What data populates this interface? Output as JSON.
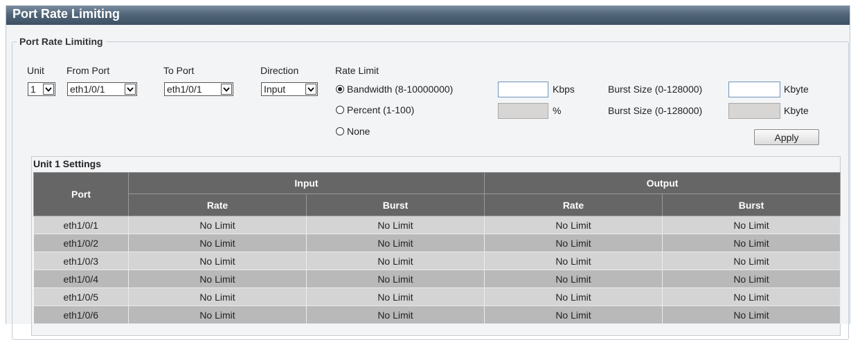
{
  "page": {
    "title": "Port Rate Limiting"
  },
  "form": {
    "legend": "Port Rate Limiting",
    "unit_label": "Unit",
    "unit_value": "1",
    "from_port_label": "From Port",
    "from_port_value": "eth1/0/1",
    "to_port_label": "To Port",
    "to_port_value": "eth1/0/1",
    "direction_label": "Direction",
    "direction_value": "Input",
    "rate_limit_label": "Rate Limit",
    "bandwidth_label": "Bandwidth (8-10000000)",
    "bandwidth_value": "",
    "bandwidth_unit": "Kbps",
    "percent_label": "Percent (1-100)",
    "percent_value": "",
    "percent_unit": "%",
    "none_label": "None",
    "selected_rate_limit": "Bandwidth",
    "burst_size_label_1": "Burst Size (0-128000)",
    "burst_size_value_1": "",
    "burst_unit_1": "Kbyte",
    "burst_size_label_2": "Burst Size (0-128000)",
    "burst_size_value_2": "",
    "burst_unit_2": "Kbyte",
    "apply_label": "Apply"
  },
  "settings": {
    "title": "Unit 1 Settings",
    "headers": {
      "port": "Port",
      "input": "Input",
      "output": "Output",
      "input_rate": "Rate",
      "input_burst": "Burst",
      "output_rate": "Rate",
      "output_burst": "Burst"
    },
    "rows": [
      {
        "port": "eth1/0/1",
        "input_rate": "No Limit",
        "input_burst": "No Limit",
        "output_rate": "No Limit",
        "output_burst": "No Limit"
      },
      {
        "port": "eth1/0/2",
        "input_rate": "No Limit",
        "input_burst": "No Limit",
        "output_rate": "No Limit",
        "output_burst": "No Limit"
      },
      {
        "port": "eth1/0/3",
        "input_rate": "No Limit",
        "input_burst": "No Limit",
        "output_rate": "No Limit",
        "output_burst": "No Limit"
      },
      {
        "port": "eth1/0/4",
        "input_rate": "No Limit",
        "input_burst": "No Limit",
        "output_rate": "No Limit",
        "output_burst": "No Limit"
      },
      {
        "port": "eth1/0/5",
        "input_rate": "No Limit",
        "input_burst": "No Limit",
        "output_rate": "No Limit",
        "output_burst": "No Limit"
      },
      {
        "port": "eth1/0/6",
        "input_rate": "No Limit",
        "input_burst": "No Limit",
        "output_rate": "No Limit",
        "output_burst": "No Limit"
      }
    ]
  },
  "icons": {
    "dropdown": "chevron-down-icon",
    "radio": "radio-icon"
  }
}
